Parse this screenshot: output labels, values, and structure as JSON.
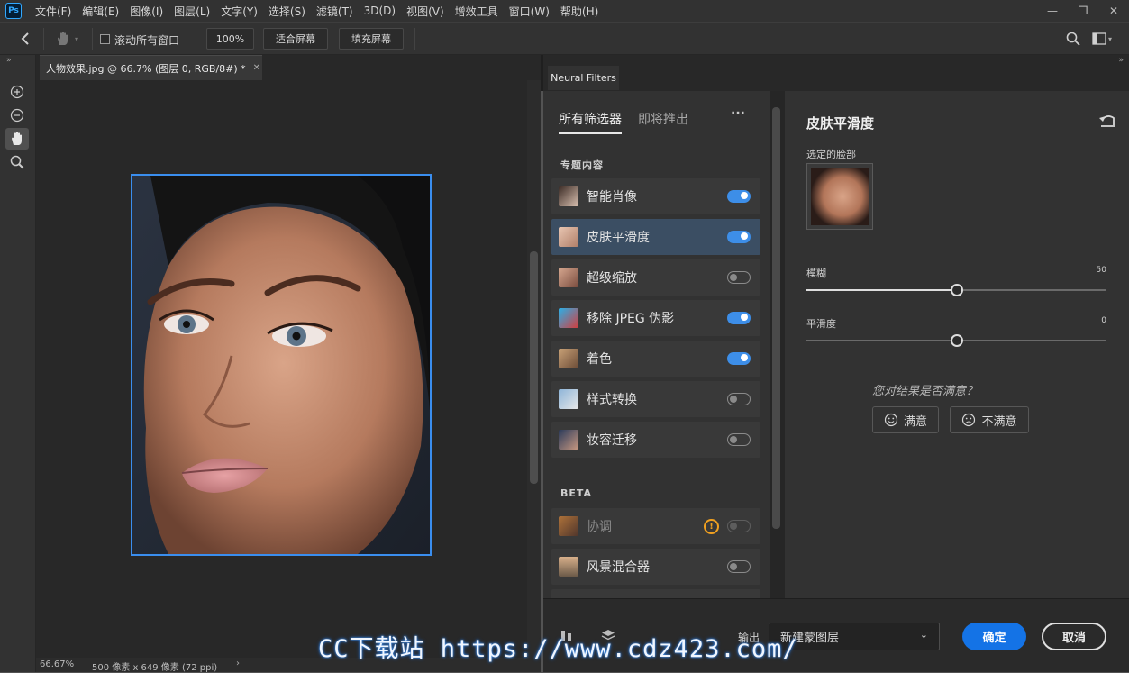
{
  "menubar": {
    "logo": "Ps",
    "items": [
      "文件(F)",
      "编辑(E)",
      "图像(I)",
      "图层(L)",
      "文字(Y)",
      "选择(S)",
      "滤镜(T)",
      "3D(D)",
      "视图(V)",
      "增效工具",
      "窗口(W)",
      "帮助(H)"
    ]
  },
  "optionsbar": {
    "scroll_all_label": "滚动所有窗口",
    "zoom_value": "100%",
    "fit_screen": "适合屏幕",
    "fill_screen": "填充屏幕"
  },
  "document": {
    "tab_title": "人物效果.jpg @ 66.7% (图层 0, RGB/8#) *",
    "zoom": "66.67%",
    "dimensions": "500 像素 x 649 像素 (72 ppi)"
  },
  "neural_filters": {
    "panel_tab": "Neural Filters",
    "tabs": [
      "所有筛选器",
      "即将推出"
    ],
    "more": "···",
    "featured_heading": "专题内容",
    "beta_heading": "BETA",
    "featured": [
      {
        "label": "智能肖像",
        "on": true
      },
      {
        "label": "皮肤平滑度",
        "on": true,
        "selected": true
      },
      {
        "label": "超级缩放",
        "on": false
      },
      {
        "label": "移除 JPEG 伪影",
        "on": true
      },
      {
        "label": "着色",
        "on": true
      },
      {
        "label": "样式转换",
        "on": false
      },
      {
        "label": "妆容迁移",
        "on": false
      }
    ],
    "beta": [
      {
        "label": "协调",
        "on": false,
        "disabled": true,
        "warning": "!"
      },
      {
        "label": "风景混合器",
        "on": false
      }
    ]
  },
  "properties": {
    "title": "皮肤平滑度",
    "selected_face_label": "选定的脸部",
    "blur_label": "模糊",
    "blur_value": "50",
    "blur_fraction": 0.5,
    "smooth_label": "平滑度",
    "smooth_value": "0",
    "smooth_fraction": 0.5,
    "feedback_question": "您对结果是否满意？",
    "satisfied": "满意",
    "unsatisfied": "不满意"
  },
  "footer": {
    "output_label": "输出",
    "output_value": "新建蒙图层",
    "ok": "确定",
    "cancel": "取消"
  },
  "watermark": "CC下载站 https://www.cdz423.com/",
  "colors": {
    "accent": "#3d8ee8",
    "ok_button": "#1473e6"
  }
}
